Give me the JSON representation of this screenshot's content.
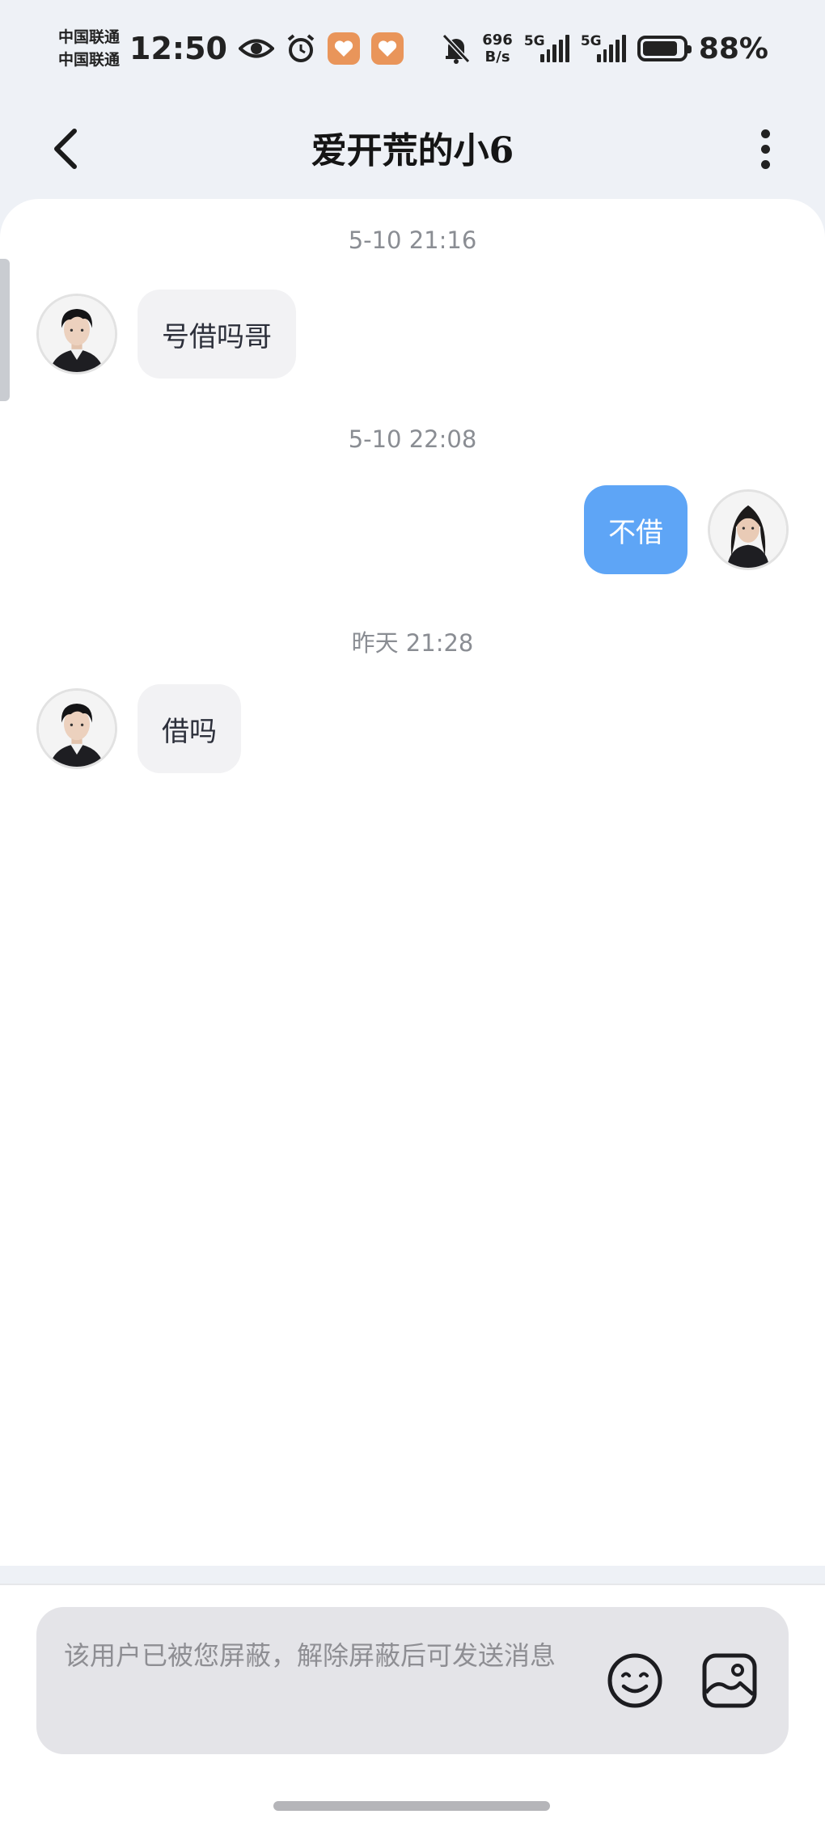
{
  "status_bar": {
    "carrier_1": "中国联通",
    "carrier_2": "中国联通",
    "time": "12:50",
    "net_speed_value": "696",
    "net_speed_unit": "B/s",
    "network_1": "5G",
    "network_2": "5G",
    "battery_percent": "88%",
    "icons": [
      "eye-icon",
      "alarm-clock-icon",
      "heart-app-icon",
      "heart-app-icon",
      "bell-muted-icon",
      "signal-icon",
      "signal-icon",
      "battery-icon"
    ]
  },
  "header": {
    "title": "爱开荒的小6",
    "back_icon": "chevron-left-icon",
    "more_icon": "more-vertical-icon"
  },
  "messages": [
    {
      "timestamp": "5-10 21:16",
      "direction": "incoming",
      "text": "号借吗哥"
    },
    {
      "timestamp": "5-10 22:08",
      "direction": "outgoing",
      "text": "不借"
    },
    {
      "timestamp": "昨天 21:28",
      "direction": "incoming",
      "text": "借吗"
    }
  ],
  "input": {
    "blocked_notice": "该用户已被您屏蔽，解除屏蔽后可发送消息",
    "emoji_icon": "smiley-icon",
    "image_icon": "image-icon"
  },
  "colors": {
    "outgoing_bubble": "#5ea5f6",
    "incoming_bubble": "#f2f2f4",
    "input_bg": "#e4e4e8"
  }
}
